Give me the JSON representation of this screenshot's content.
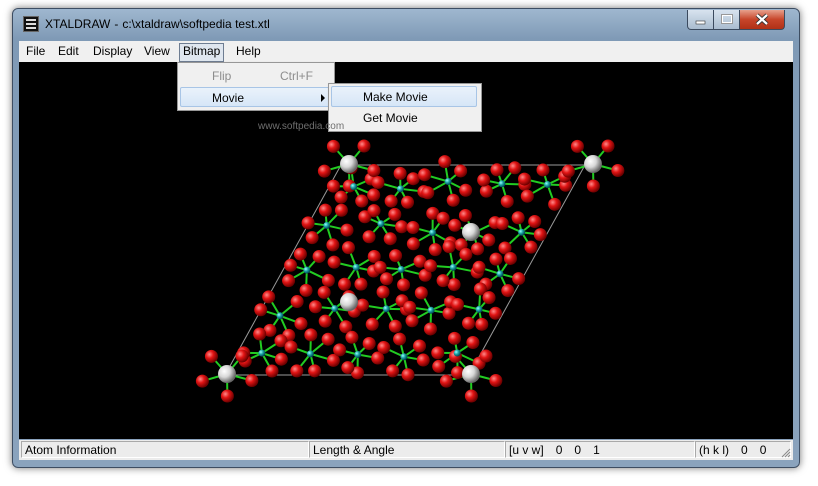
{
  "window": {
    "app_name": "XTALDRAW",
    "separator": "-",
    "file_path": "c:\\xtaldraw\\softpedia test.xtl"
  },
  "menubar": [
    "File",
    "Edit",
    "Display",
    "View",
    "Bitmap",
    "Help"
  ],
  "bitmap_menu": {
    "flip_label": "Flip",
    "flip_shortcut": "Ctrl+F",
    "movie_label": "Movie"
  },
  "movie_submenu": {
    "make_movie": "Make Movie",
    "get_movie": "Get Movie"
  },
  "watermark": "www.softpedia.com",
  "statusbar": {
    "atom_info": "Atom Information",
    "length_angle": "Length & Angle",
    "uvw_label": "[u v w]",
    "uvw_values": [
      "0",
      "0",
      "1"
    ],
    "hkl_label": "(h k l)",
    "hkl_values": [
      "0",
      "0"
    ]
  },
  "colors": {
    "oxygen": "#e21414",
    "bond": "#22cc22",
    "cation": "#1aa3a3",
    "heavy_atom": "#d8d8d8",
    "canvas": "#000000"
  }
}
